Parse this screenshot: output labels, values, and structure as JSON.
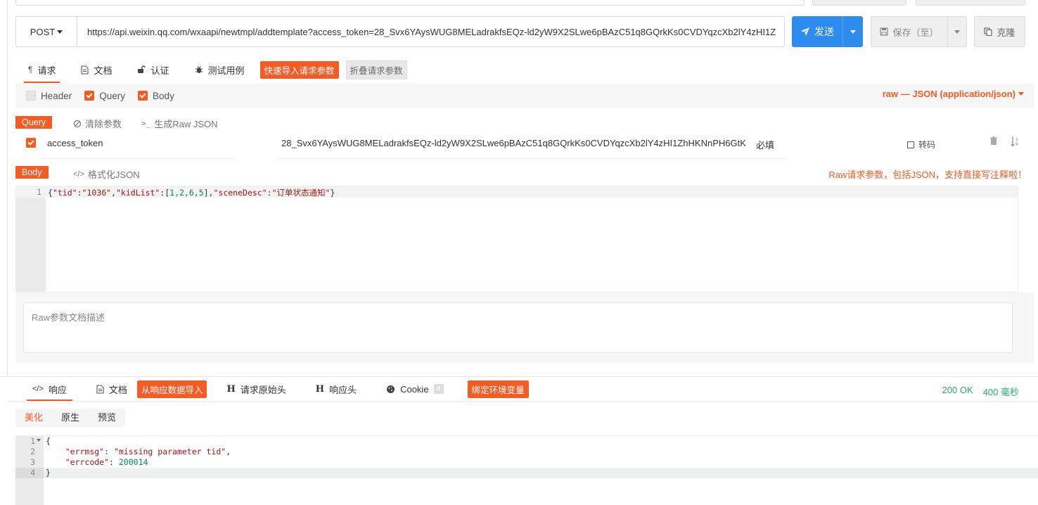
{
  "colors": {
    "accent": "#f55b23",
    "primary": "#2d8cf0",
    "success": "#2dab69"
  },
  "request": {
    "method": "POST",
    "url": "https://api.weixin.qq.com/wxaapi/newtmpl/addtemplate?access_token=28_Svx6YAysWUG8MELadrakfsEQz-ld2yW9X2SLwe6pBAzC51q8GQrkKs0CVDYqzcXb2lY4zHI1Z",
    "send_label": "发送",
    "save_label": "保存（至）",
    "clone_label": "克隆"
  },
  "tabs": {
    "request": "请求",
    "docs": "文档",
    "auth": "认证",
    "tests": "测试用例",
    "import_params": "快速导入请求参数",
    "collapse_params": "折叠请求参数"
  },
  "options": {
    "header": "Header",
    "query": "Query",
    "body": "Body",
    "header_checked": false,
    "query_checked": true,
    "body_checked": true,
    "body_type": "raw — JSON (application/json)"
  },
  "query": {
    "label": "Query",
    "clear_label": "清除参数",
    "gen_raw_label": "生成Raw JSON",
    "params": [
      {
        "enabled": true,
        "key": "access_token",
        "value": "28_Svx6YAysWUG8MELadrakfsEQz-ld2yW9X2SLwe6pBAzC51q8GQrkKs0CVDYqzcXb2lY4zHI1ZhHKNnPH6GtK",
        "required": "必填",
        "encode_label": "转码"
      }
    ]
  },
  "body": {
    "label": "Body",
    "format_label": "格式化JSON",
    "hint": "Raw请求参数，包括JSON，支持直接写注释啦！",
    "line_number": "1",
    "raw": {
      "tid_key": "\"tid\"",
      "tid_value": "\"1036\"",
      "kidList_key": "\"kidList\"",
      "kidList_values": "1,2,6,5",
      "sceneDesc_key": "\"sceneDesc\"",
      "sceneDesc_value": "\"订单状态通知\""
    },
    "desc_placeholder": "Raw参数文档描述"
  },
  "response": {
    "tabs": {
      "response": "响应",
      "docs": "文档",
      "import_from_response": "从响应数据导入",
      "request_headers": "请求原始头",
      "response_headers": "响应头",
      "cookie": "Cookie",
      "cookie_count": "4",
      "bind_env": "绑定环境变量"
    },
    "status": "200 OK",
    "time": "400 毫秒",
    "view_modes": [
      "美化",
      "原生",
      "预览"
    ],
    "line_numbers": [
      "1",
      "2",
      "3",
      "4"
    ],
    "json": {
      "errmsg_key": "\"errmsg\"",
      "errmsg_value": "\"missing parameter tid\"",
      "errcode_key": "\"errcode\"",
      "errcode_value": "200014"
    }
  }
}
